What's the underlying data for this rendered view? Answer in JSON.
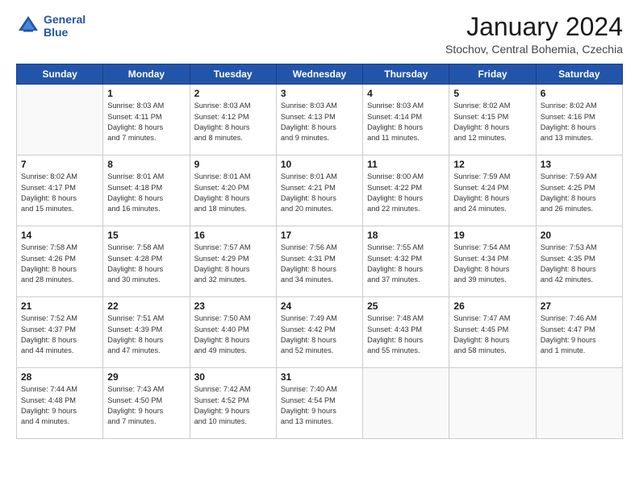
{
  "logo": {
    "line1": "General",
    "line2": "Blue"
  },
  "title": "January 2024",
  "subtitle": "Stochov, Central Bohemia, Czechia",
  "days_header": [
    "Sunday",
    "Monday",
    "Tuesday",
    "Wednesday",
    "Thursday",
    "Friday",
    "Saturday"
  ],
  "weeks": [
    [
      {
        "day": "",
        "info": ""
      },
      {
        "day": "1",
        "info": "Sunrise: 8:03 AM\nSunset: 4:11 PM\nDaylight: 8 hours\nand 7 minutes."
      },
      {
        "day": "2",
        "info": "Sunrise: 8:03 AM\nSunset: 4:12 PM\nDaylight: 8 hours\nand 8 minutes."
      },
      {
        "day": "3",
        "info": "Sunrise: 8:03 AM\nSunset: 4:13 PM\nDaylight: 8 hours\nand 9 minutes."
      },
      {
        "day": "4",
        "info": "Sunrise: 8:03 AM\nSunset: 4:14 PM\nDaylight: 8 hours\nand 11 minutes."
      },
      {
        "day": "5",
        "info": "Sunrise: 8:02 AM\nSunset: 4:15 PM\nDaylight: 8 hours\nand 12 minutes."
      },
      {
        "day": "6",
        "info": "Sunrise: 8:02 AM\nSunset: 4:16 PM\nDaylight: 8 hours\nand 13 minutes."
      }
    ],
    [
      {
        "day": "7",
        "info": "Sunrise: 8:02 AM\nSunset: 4:17 PM\nDaylight: 8 hours\nand 15 minutes."
      },
      {
        "day": "8",
        "info": "Sunrise: 8:01 AM\nSunset: 4:18 PM\nDaylight: 8 hours\nand 16 minutes."
      },
      {
        "day": "9",
        "info": "Sunrise: 8:01 AM\nSunset: 4:20 PM\nDaylight: 8 hours\nand 18 minutes."
      },
      {
        "day": "10",
        "info": "Sunrise: 8:01 AM\nSunset: 4:21 PM\nDaylight: 8 hours\nand 20 minutes."
      },
      {
        "day": "11",
        "info": "Sunrise: 8:00 AM\nSunset: 4:22 PM\nDaylight: 8 hours\nand 22 minutes."
      },
      {
        "day": "12",
        "info": "Sunrise: 7:59 AM\nSunset: 4:24 PM\nDaylight: 8 hours\nand 24 minutes."
      },
      {
        "day": "13",
        "info": "Sunrise: 7:59 AM\nSunset: 4:25 PM\nDaylight: 8 hours\nand 26 minutes."
      }
    ],
    [
      {
        "day": "14",
        "info": "Sunrise: 7:58 AM\nSunset: 4:26 PM\nDaylight: 8 hours\nand 28 minutes."
      },
      {
        "day": "15",
        "info": "Sunrise: 7:58 AM\nSunset: 4:28 PM\nDaylight: 8 hours\nand 30 minutes."
      },
      {
        "day": "16",
        "info": "Sunrise: 7:57 AM\nSunset: 4:29 PM\nDaylight: 8 hours\nand 32 minutes."
      },
      {
        "day": "17",
        "info": "Sunrise: 7:56 AM\nSunset: 4:31 PM\nDaylight: 8 hours\nand 34 minutes."
      },
      {
        "day": "18",
        "info": "Sunrise: 7:55 AM\nSunset: 4:32 PM\nDaylight: 8 hours\nand 37 minutes."
      },
      {
        "day": "19",
        "info": "Sunrise: 7:54 AM\nSunset: 4:34 PM\nDaylight: 8 hours\nand 39 minutes."
      },
      {
        "day": "20",
        "info": "Sunrise: 7:53 AM\nSunset: 4:35 PM\nDaylight: 8 hours\nand 42 minutes."
      }
    ],
    [
      {
        "day": "21",
        "info": "Sunrise: 7:52 AM\nSunset: 4:37 PM\nDaylight: 8 hours\nand 44 minutes."
      },
      {
        "day": "22",
        "info": "Sunrise: 7:51 AM\nSunset: 4:39 PM\nDaylight: 8 hours\nand 47 minutes."
      },
      {
        "day": "23",
        "info": "Sunrise: 7:50 AM\nSunset: 4:40 PM\nDaylight: 8 hours\nand 49 minutes."
      },
      {
        "day": "24",
        "info": "Sunrise: 7:49 AM\nSunset: 4:42 PM\nDaylight: 8 hours\nand 52 minutes."
      },
      {
        "day": "25",
        "info": "Sunrise: 7:48 AM\nSunset: 4:43 PM\nDaylight: 8 hours\nand 55 minutes."
      },
      {
        "day": "26",
        "info": "Sunrise: 7:47 AM\nSunset: 4:45 PM\nDaylight: 8 hours\nand 58 minutes."
      },
      {
        "day": "27",
        "info": "Sunrise: 7:46 AM\nSunset: 4:47 PM\nDaylight: 9 hours\nand 1 minute."
      }
    ],
    [
      {
        "day": "28",
        "info": "Sunrise: 7:44 AM\nSunset: 4:48 PM\nDaylight: 9 hours\nand 4 minutes."
      },
      {
        "day": "29",
        "info": "Sunrise: 7:43 AM\nSunset: 4:50 PM\nDaylight: 9 hours\nand 7 minutes."
      },
      {
        "day": "30",
        "info": "Sunrise: 7:42 AM\nSunset: 4:52 PM\nDaylight: 9 hours\nand 10 minutes."
      },
      {
        "day": "31",
        "info": "Sunrise: 7:40 AM\nSunset: 4:54 PM\nDaylight: 9 hours\nand 13 minutes."
      },
      {
        "day": "",
        "info": ""
      },
      {
        "day": "",
        "info": ""
      },
      {
        "day": "",
        "info": ""
      }
    ]
  ]
}
